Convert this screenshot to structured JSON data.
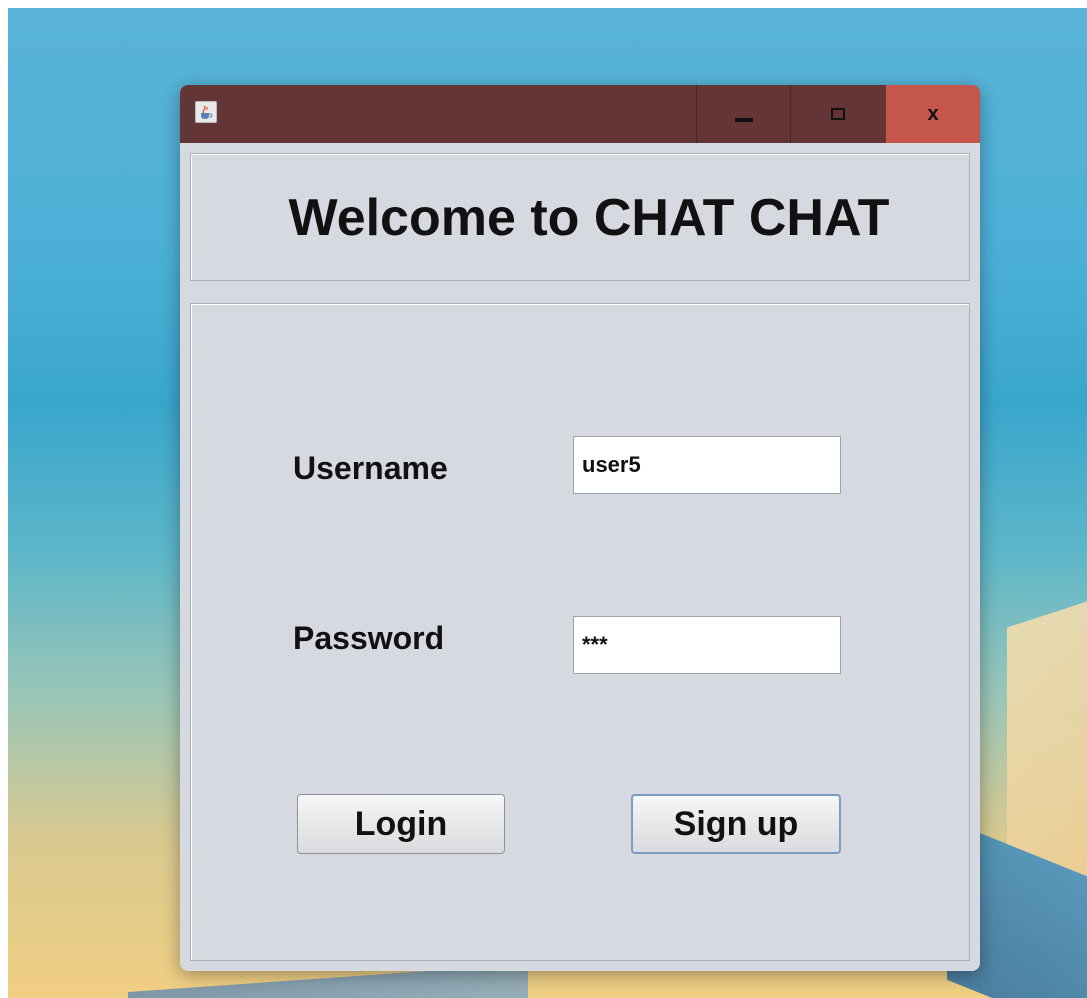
{
  "window": {
    "title": "",
    "controls": {
      "minimize": "minimize",
      "maximize": "maximize",
      "close": "x"
    }
  },
  "header": {
    "title": "Welcome to CHAT CHAT"
  },
  "form": {
    "username_label": "Username",
    "username_value": "user5",
    "password_label": "Password",
    "password_value": "***"
  },
  "actions": {
    "login_label": "Login",
    "signup_label": "Sign up"
  },
  "colors": {
    "titlebar": "#633536",
    "close_button": "#c4564c",
    "panel_background": "#d6d9e0"
  },
  "icons": {
    "app": "java-coffee-cup-icon"
  }
}
